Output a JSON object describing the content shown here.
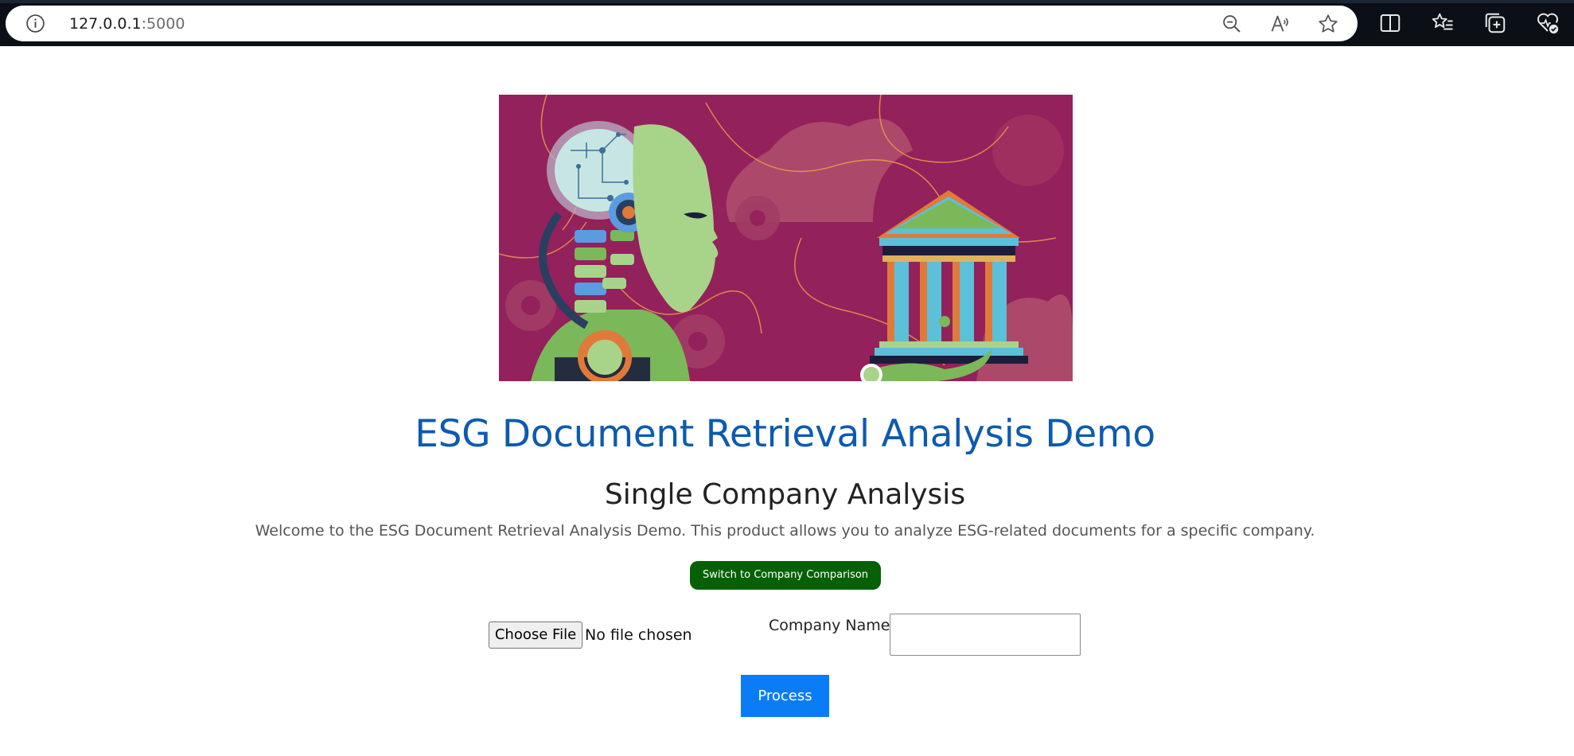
{
  "browser": {
    "url_host": "127.0.0.1",
    "url_port": ":5000",
    "icons": [
      "info-icon",
      "zoom-out-icon",
      "read-aloud-icon",
      "favorite-star-icon",
      "split-screen-icon",
      "favorites-list-icon",
      "collections-icon",
      "browser-essentials-icon"
    ]
  },
  "page": {
    "hero_image": "esg-hero-illustration",
    "title": "ESG Document Retrieval Analysis Demo",
    "section_title": "Single Company Analysis",
    "intro": "Welcome to the ESG Document Retrieval Analysis Demo. This product allows you to analyze ESG-related documents for a specific company.",
    "switch_button": "Switch to Company Comparison",
    "file_button": "Choose File",
    "file_status": "No file chosen",
    "company_label": "Company Name:",
    "company_value": "",
    "process_button": "Process"
  },
  "colors": {
    "title": "#0d5ab0",
    "switch_button_bg": "#066106",
    "process_button_bg": "#0a7cf5",
    "hero_bg": "#93215b"
  }
}
